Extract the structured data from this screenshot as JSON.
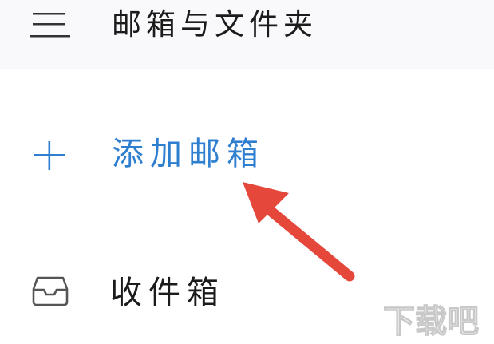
{
  "header": {
    "title": "邮箱与文件夹",
    "menu_icon": "hamburger-menu-icon"
  },
  "menu": {
    "items": [
      {
        "label": "添加邮箱",
        "icon": "plus-icon",
        "color": "#2f7fd1"
      },
      {
        "label": "收件箱",
        "icon": "inbox-tray-icon",
        "color": "#1b1b1b"
      }
    ]
  },
  "annotation": {
    "arrow_color": "#e5473b",
    "arrow_icon": "red-pointer-arrow-icon"
  },
  "watermark": {
    "text": "下载吧"
  }
}
